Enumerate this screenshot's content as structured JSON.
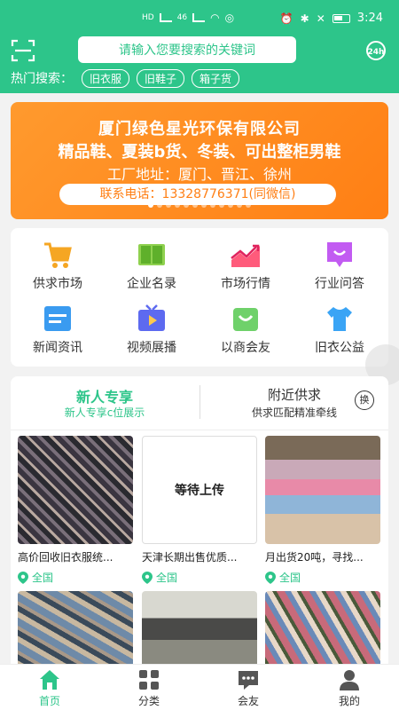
{
  "status_bar": {
    "time": "3:24",
    "left_badges": [
      "HD",
      "4G",
      "46",
      "HD"
    ]
  },
  "header": {
    "search_placeholder": "请输入您要搜索的关键词",
    "hot_label": "热门搜索：",
    "hot_tags": [
      "旧衣服",
      "旧鞋子",
      "箱子货"
    ],
    "badge_24h": "24h"
  },
  "banner": {
    "line1": "厦门绿色星光环保有限公司",
    "line2": "精品鞋、夏装b货、冬装、可出整柜男鞋",
    "line3": "工厂地址：厦门、晋江、徐州",
    "line4": "联系电话：13328776371(同微信)",
    "slide_count": 12,
    "active_slide": 1
  },
  "menu": {
    "items": [
      {
        "label": "供求市场",
        "icon": "cart-icon"
      },
      {
        "label": "企业名录",
        "icon": "book-icon"
      },
      {
        "label": "市场行情",
        "icon": "trend-chart-icon"
      },
      {
        "label": "行业问答",
        "icon": "chat-bubble-icon"
      },
      {
        "label": "新闻资讯",
        "icon": "news-icon"
      },
      {
        "label": "视频展播",
        "icon": "tv-icon"
      },
      {
        "label": "以商会友",
        "icon": "shopping-bag-icon"
      },
      {
        "label": "旧衣公益",
        "icon": "shirt-icon"
      }
    ]
  },
  "tabs": {
    "left_title": "新人专享",
    "left_sub": "新人专享c位展示",
    "right_title": "附近供求",
    "right_sub": "供求匹配精准牵线",
    "swap_label": "换"
  },
  "cards": [
    {
      "title": "高价回收旧衣服统...",
      "location": "全国"
    },
    {
      "title": "天津长期出售优质...",
      "location": "全国",
      "placeholder": "等待上传"
    },
    {
      "title": "月出货20吨，寻找...",
      "location": "全国"
    }
  ],
  "bottom_nav": [
    {
      "label": "首页",
      "active": true
    },
    {
      "label": "分类",
      "active": false
    },
    {
      "label": "会友",
      "active": false
    },
    {
      "label": "我的",
      "active": false
    }
  ],
  "colors": {
    "brand": "#2dc58a",
    "banner": "#ff8a1f"
  }
}
